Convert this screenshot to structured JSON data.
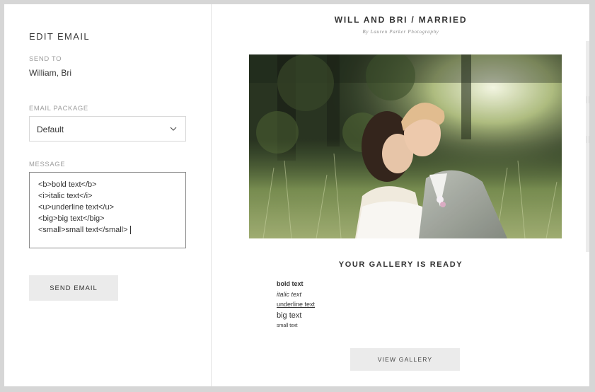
{
  "editor": {
    "title": "EDIT EMAIL",
    "send_to_label": "SEND TO",
    "send_to_value": "William, Bri",
    "package_label": "EMAIL PACKAGE",
    "package_value": "Default",
    "message_label": "MESSAGE",
    "message_lines": [
      "<b>bold text</b>",
      "<i>italic text</i>",
      "<u>underline text</u>",
      "<big>big text</big>",
      "<small>small text</small>"
    ],
    "send_button": "SEND EMAIL"
  },
  "preview": {
    "title": "WILL AND BRI / MARRIED",
    "subtitle": "By Lauren Parker Photography",
    "heading": "YOUR GALLERY IS READY",
    "bold_text": "bold text",
    "italic_text": "italic text",
    "underline_text": "underline text",
    "big_text": "big text",
    "small_text": "small text",
    "view_button": "VIEW GALLERY"
  },
  "colors": {
    "frame_bg": "#d6d6d6",
    "button_bg": "#ebebeb",
    "label_gray": "#9d9d9d"
  }
}
